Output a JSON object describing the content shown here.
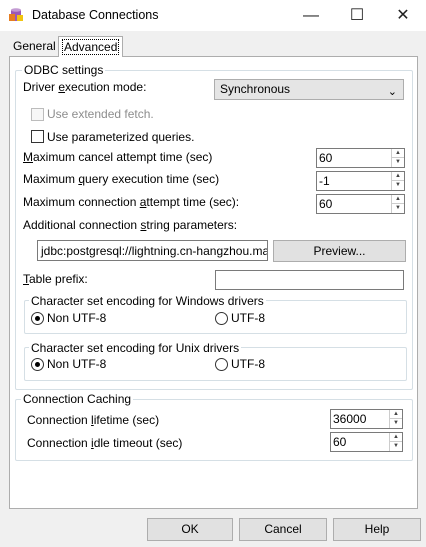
{
  "window": {
    "title": "Database Connections",
    "minimize_glyph": "—",
    "maximize_glyph": "☐",
    "close_glyph": "✕"
  },
  "tabs": [
    {
      "label": "General",
      "selected": false
    },
    {
      "label": "Advanced",
      "selected": true
    }
  ],
  "odbc": {
    "group_label": "ODBC settings",
    "driver_mode_label_pre": "Driver ",
    "driver_mode_label_u": "e",
    "driver_mode_label_post": "xecution mode:",
    "driver_mode_value": "Synchronous",
    "use_extended_fetch": "Use extended fetch.",
    "use_parameterized": "Use parameterized queries.",
    "max_cancel_pre": "",
    "max_cancel_u": "M",
    "max_cancel_post": "aximum cancel attempt time (sec)",
    "max_cancel_value": "60",
    "max_query_pre": "Maximum ",
    "max_query_u": "q",
    "max_query_post": "uery execution time (sec)",
    "max_query_value": "-1",
    "max_conn_pre": "Maximum connection ",
    "max_conn_u": "a",
    "max_conn_post": "ttempt time (sec):",
    "max_conn_value": "60",
    "addl_label_pre": "Additional connection ",
    "addl_label_u": "s",
    "addl_label_post": "tring parameters:",
    "addl_value": "jdbc:postgresql://lightning.cn-hangzhou.maxcompute",
    "preview_label": "Preview...",
    "table_prefix_pre": "",
    "table_prefix_u": "T",
    "table_prefix_post": "able prefix:",
    "table_prefix_value": ""
  },
  "windows_enc": {
    "group_label": "Character set encoding for Windows drivers",
    "option1": "Non UTF-8",
    "option2": "UTF-8"
  },
  "unix_enc": {
    "group_label": "Character set encoding for Unix drivers",
    "option1": "Non UTF-8",
    "option2": "UTF-8"
  },
  "caching": {
    "group_label": "Connection Caching",
    "lifetime_pre": "Connection ",
    "lifetime_u": "l",
    "lifetime_post": "ifetime (sec)",
    "lifetime_value": "36000",
    "idle_pre": "Connection ",
    "idle_u": "i",
    "idle_post": "dle timeout (sec)",
    "idle_value": "60"
  },
  "footer": {
    "ok": "OK",
    "cancel": "Cancel",
    "help": "Help"
  }
}
